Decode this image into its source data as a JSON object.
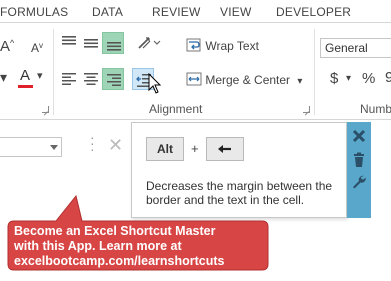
{
  "ribbon": {
    "tabs": [
      "FORMULAS",
      "DATA",
      "REVIEW",
      "VIEW",
      "DEVELOPER"
    ],
    "alignment": {
      "group_label": "Alignment",
      "wrap_text_label": "Wrap Text",
      "merge_center_label": "Merge & Center"
    },
    "font": {
      "increase_size_glyph": "A",
      "decrease_size_glyph": "A",
      "font_color_glyph": "A"
    },
    "number": {
      "format_value": "General",
      "currency_glyph": "$",
      "percent_glyph": "%",
      "group_label_partial": "Numb"
    }
  },
  "popup": {
    "keys": [
      "Alt",
      "+"
    ],
    "description": "Decreases the margin between the border and the text in the cell."
  },
  "callout": {
    "lines": [
      "Become an Excel Shortcut Master",
      "with this App. Learn more at",
      "excelbootcamp.com/learnshortcuts"
    ]
  },
  "colors": {
    "active_button_bg": "#9fd5b7",
    "popup_side_bar": "#5aa7cc",
    "callout_bg": "#d84545",
    "font_color_bar": "#e0202a"
  }
}
